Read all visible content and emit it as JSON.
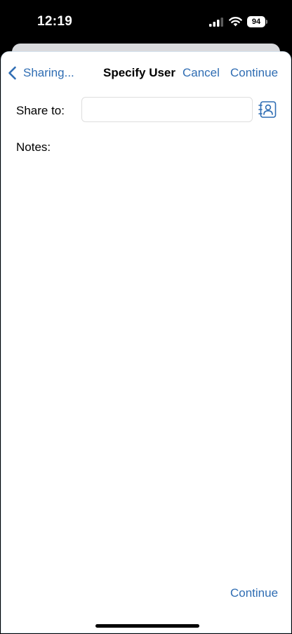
{
  "status_bar": {
    "time": "12:19",
    "battery_level": "94",
    "icons": [
      "signal-icon",
      "wifi-icon",
      "battery-icon"
    ]
  },
  "nav": {
    "back_label": "Sharing...",
    "title": "Specify User",
    "cancel_label": "Cancel",
    "continue_label": "Continue"
  },
  "form": {
    "share_label": "Share to:",
    "share_value": "",
    "contacts_icon": "contacts-icon",
    "notes_label": "Notes:",
    "notes_value": ""
  },
  "footer": {
    "continue_label": "Continue"
  },
  "colors": {
    "accent": "#2f6db3",
    "background": "#ffffff",
    "status_bar": "#000000"
  }
}
